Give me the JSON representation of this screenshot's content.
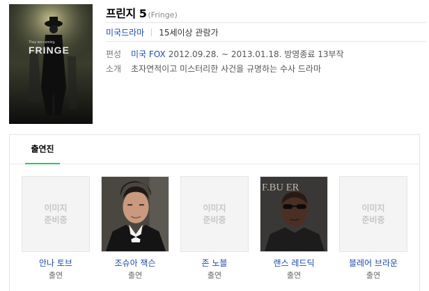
{
  "show": {
    "title": "프린지 5",
    "original_title": "(Fringe)",
    "genre": "미국드라마",
    "rating": "15세이상 관람가",
    "poster_tagline": "They are coming.",
    "poster_logo": "FRINGE"
  },
  "details": {
    "broadcast_label": "편성",
    "broadcast_link": "미국 FOX",
    "broadcast_text": "2012.09.28. ~ 2013.01.18. 방영종료 13부작",
    "summary_label": "소개",
    "summary_text": "초자연적이고 미스터리한 사건을 규명하는 수사 드라마"
  },
  "cast": {
    "tab_label": "출연진",
    "accent": "#19ce60",
    "members": [
      {
        "name": "안나 토브",
        "role": "출연",
        "has_photo": false,
        "placeholder": "이미지\n준비중"
      },
      {
        "name": "조슈아 잭슨",
        "role": "출연",
        "has_photo": true,
        "placeholder": ""
      },
      {
        "name": "존 노블",
        "role": "출연",
        "has_photo": false,
        "placeholder": "이미지\n준비중"
      },
      {
        "name": "랜스 레드딕",
        "role": "출연",
        "has_photo": true,
        "placeholder": "",
        "backdrop_text": "F.BU   ER"
      },
      {
        "name": "블레어 브라운",
        "role": "출연",
        "has_photo": false,
        "placeholder": "이미지\n준비중"
      }
    ]
  },
  "colors": {
    "link": "#1d48b4",
    "poster_bg": "#1a1a1a"
  }
}
